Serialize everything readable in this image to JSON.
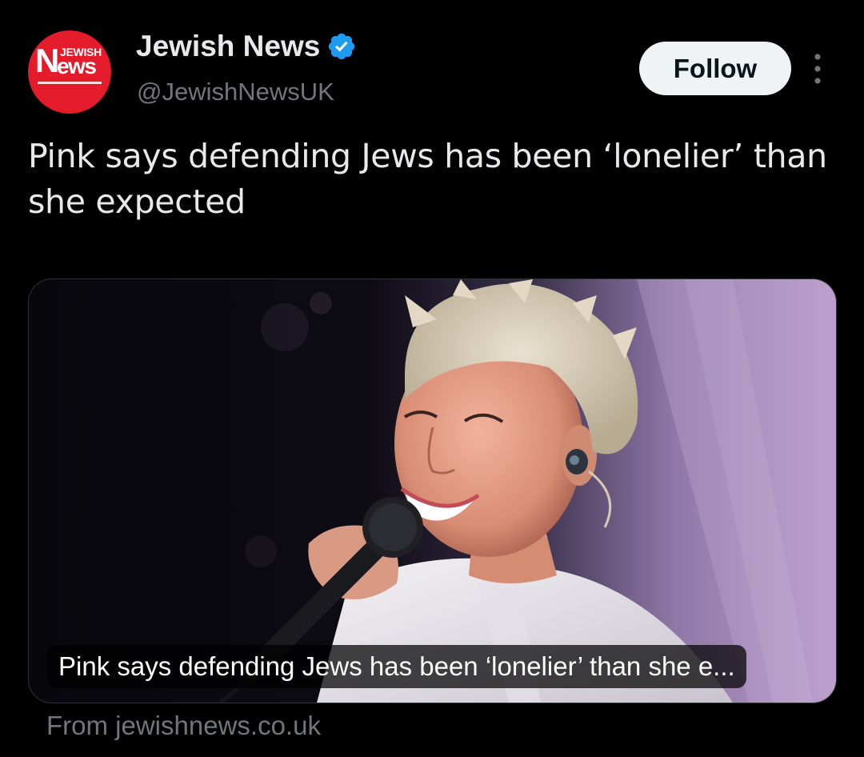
{
  "tweet": {
    "author": {
      "display_name": "Jewish News",
      "handle": "@JewishNewsUK",
      "verified": true,
      "avatar": {
        "logo_top": "JEWISH",
        "logo_letter": "N",
        "logo_word": "ews",
        "icon": "jewish-news-logo",
        "color": "#e31b2b"
      }
    },
    "follow_label": "Follow",
    "more_icon": "more-vertical-icon",
    "text": "Pink says defending Jews has been ‘lonelier’ than she expected",
    "card": {
      "caption": "Pink says defending Jews has been ‘lonelier’ than she e...",
      "source": "From jewishnews.co.uk"
    }
  },
  "colors": {
    "background": "#000000",
    "text_primary": "#e7e9ea",
    "text_secondary": "#71767b",
    "verified_blue": "#1d9bf0",
    "follow_bg": "#eff3f4"
  }
}
